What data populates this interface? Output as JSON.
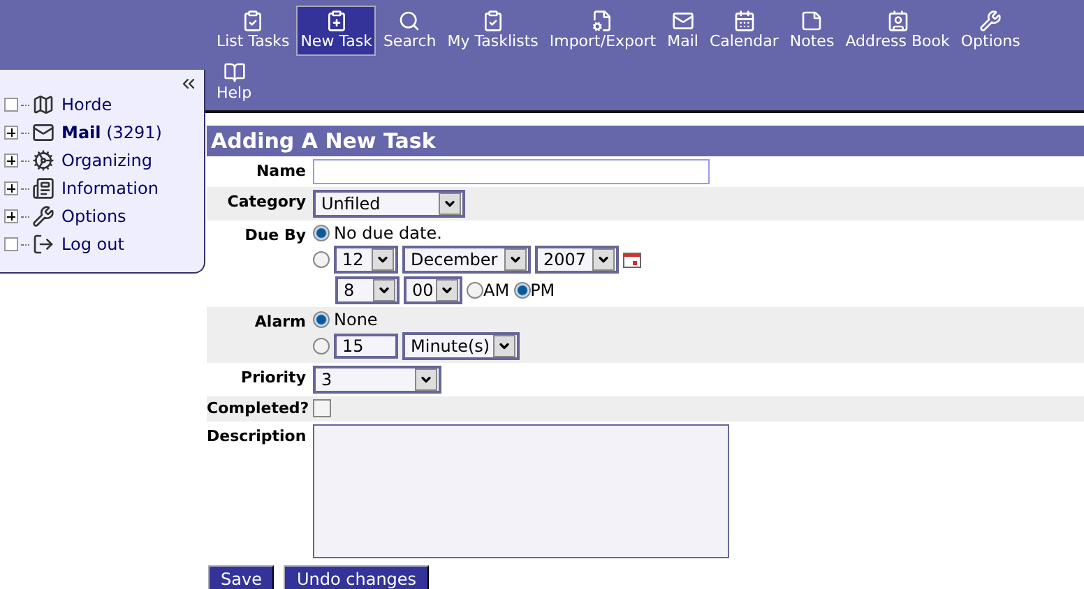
{
  "toolbar": {
    "rows": [
      [
        {
          "label": "List Tasks",
          "selected": false
        },
        {
          "label": "New Task",
          "selected": true
        },
        {
          "label": "Search",
          "selected": false
        },
        {
          "label": "My Tasklists",
          "selected": false
        },
        {
          "label": "Import/Export",
          "selected": false
        },
        {
          "label": "Mail",
          "selected": false
        },
        {
          "label": "Calendar",
          "selected": false
        },
        {
          "label": "Notes",
          "selected": false
        },
        {
          "label": "Address Book",
          "selected": false
        },
        {
          "label": "Options",
          "selected": false
        }
      ],
      [
        {
          "label": "Help",
          "selected": false
        }
      ]
    ]
  },
  "sidebar": {
    "items": [
      {
        "label": "Horde",
        "has_children": false
      },
      {
        "label": "**Mail** (3291)",
        "has_children": true
      },
      {
        "label": "Organizing",
        "has_children": true
      },
      {
        "label": "Information",
        "has_children": true
      },
      {
        "label": "Options",
        "has_children": true
      },
      {
        "label": "Log out",
        "has_children": false
      }
    ]
  },
  "form": {
    "title": "Adding A New Task",
    "name": {
      "label": "Name"
    },
    "category": {
      "label": "Category",
      "value": "Unfiled"
    },
    "due_by": {
      "label": "Due By",
      "no_date": {
        "label": "No due date.",
        "selected": true
      },
      "date": {
        "selected": false,
        "day": "12",
        "month": "December",
        "year": "2007",
        "hour": "8",
        "minute": "00",
        "ampm": [
          {
            "label": "AM",
            "selected": false
          },
          {
            "label": "PM",
            "selected": true
          }
        ]
      }
    },
    "alarm": {
      "label": "Alarm",
      "none": {
        "label": "None",
        "selected": true
      },
      "custom": {
        "selected": false,
        "amount": "15",
        "unit": "Minute(s)"
      }
    },
    "priority": {
      "label": "Priority",
      "value": "3"
    },
    "completed": {
      "label": "Completed?",
      "checked": false
    },
    "description": {
      "label": "Description"
    },
    "buttons": [
      {
        "label": "Save"
      },
      {
        "label": "Undo changes"
      }
    ]
  }
}
